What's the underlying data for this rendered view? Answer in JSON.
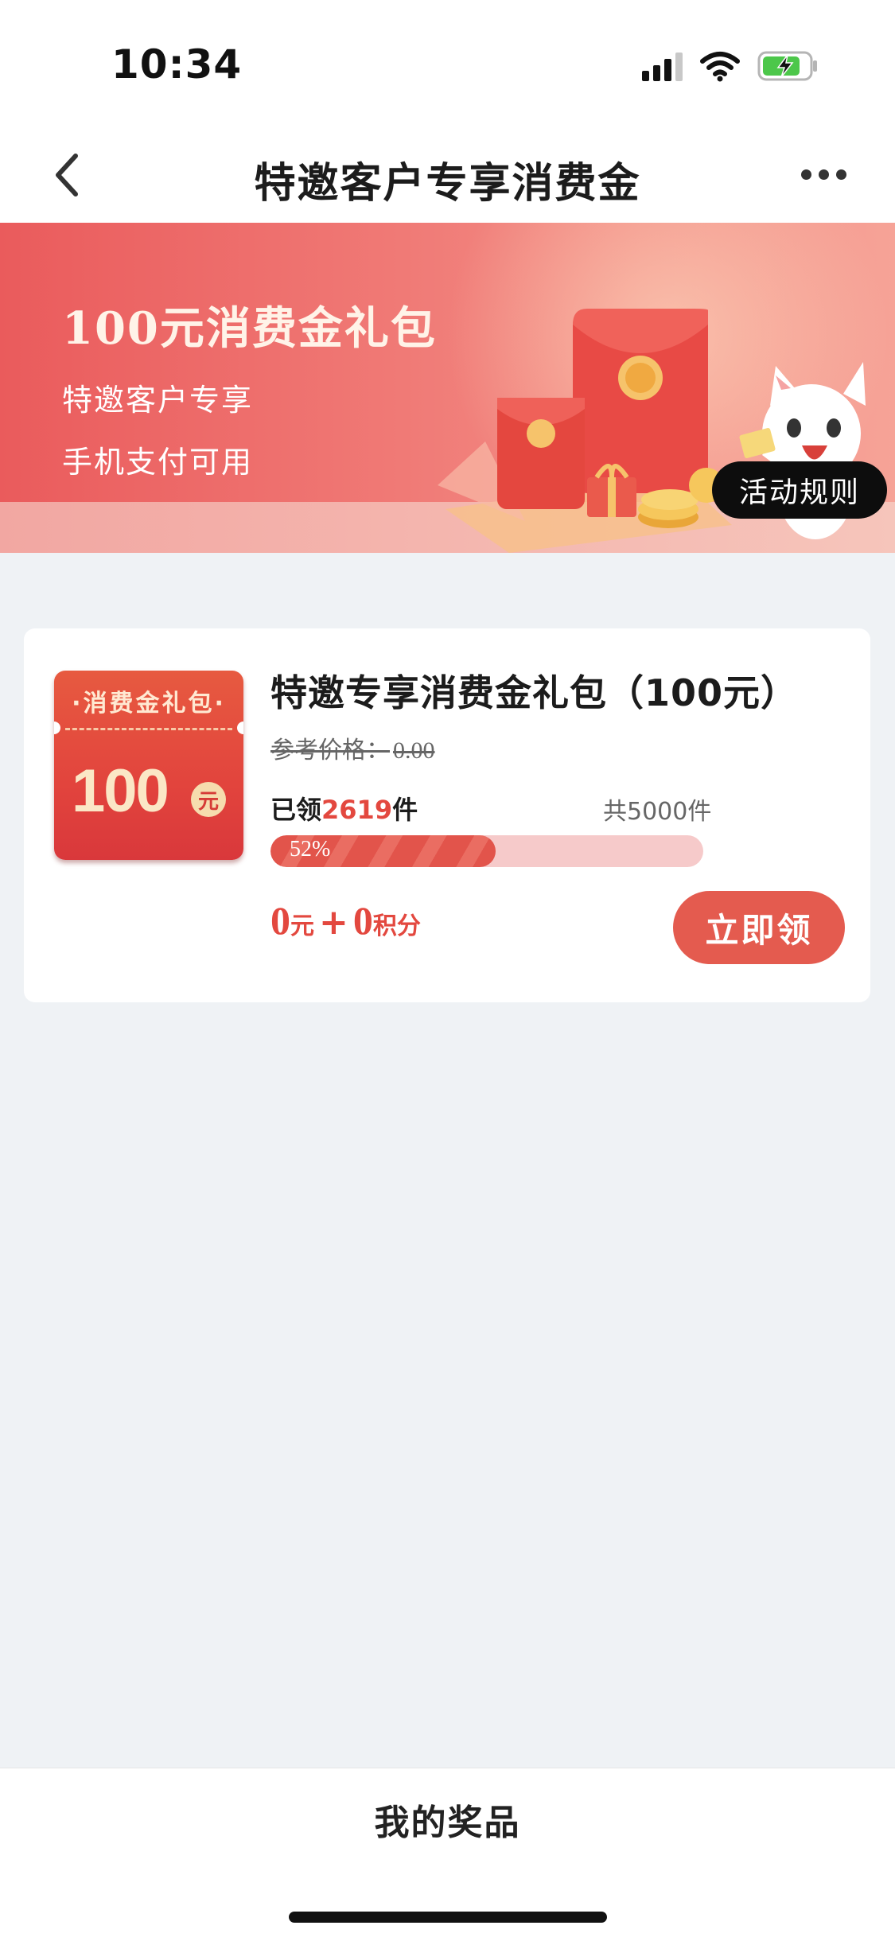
{
  "status_bar": {
    "time": "10:34"
  },
  "nav": {
    "title": "特邀客户专享消费金"
  },
  "banner": {
    "title": "100元消费金礼包",
    "subtitle_1": "特邀客户专享",
    "subtitle_2": "手机支付可用",
    "rules_button": "活动规则"
  },
  "product": {
    "coupon_label": "·消费金礼包·",
    "coupon_amount": "100",
    "coupon_unit": "元",
    "title": "特邀专享消费金礼包（100元）",
    "ref_price_label": "参考价格：",
    "ref_price_value": "0.00",
    "claimed_prefix": "已领",
    "claimed_count": "2619",
    "claimed_suffix": "件",
    "total_text": "共5000件",
    "progress_percent": 52,
    "progress_text": "52%",
    "price_cash": "0",
    "price_cash_unit": "元",
    "price_plus": "+",
    "price_points": "0",
    "price_points_unit": "积分",
    "claim_button": "立即领"
  },
  "bottom": {
    "my_prizes": "我的奖品"
  },
  "colors": {
    "accent": "#e3483f",
    "background": "#eff2f5"
  }
}
